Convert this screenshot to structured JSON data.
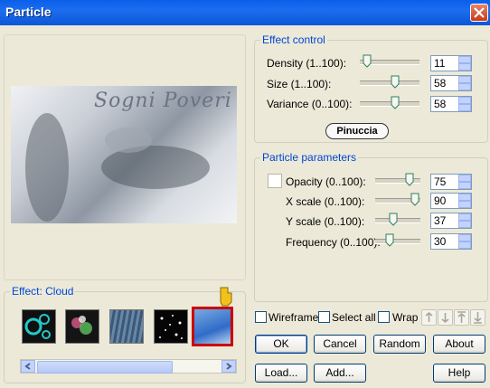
{
  "window": {
    "title": "Particle",
    "close_icon": "close-icon"
  },
  "effect_control": {
    "legend": "Effect control",
    "rows": [
      {
        "label": "Density (1..100):",
        "value": "11",
        "level": 11
      },
      {
        "label": "Size (1..100):",
        "value": "58",
        "level": 58
      },
      {
        "label": "Variance (0..100):",
        "value": "58",
        "level": 58
      }
    ]
  },
  "watermark": {
    "text": "Pinuccia"
  },
  "preview": {
    "logo_text": "Sogni Poveri"
  },
  "particle_parameters": {
    "legend": "Particle parameters",
    "rows": [
      {
        "label": "Opacity (0..100):",
        "value": "75",
        "level": 75
      },
      {
        "label": "X scale (0..100):",
        "value": "90",
        "level": 90
      },
      {
        "label": "Y scale (0..100):",
        "value": "37",
        "level": 37
      },
      {
        "label": "Frequency (0..100):",
        "value": "30",
        "level": 30
      }
    ]
  },
  "effect_group": {
    "legend": "Effect: Cloud"
  },
  "options": {
    "wireframe": "Wireframe",
    "select_all": "Select all",
    "wrap": "Wrap"
  },
  "buttons": {
    "ok": "OK",
    "cancel": "Cancel",
    "random": "Random",
    "about": "About",
    "load": "Load...",
    "add": "Add...",
    "help": "Help"
  },
  "colors": {
    "title_bar": "#0a5ee8",
    "legend_text": "#0046d5",
    "selected_thumb_border": "#cc0000"
  }
}
